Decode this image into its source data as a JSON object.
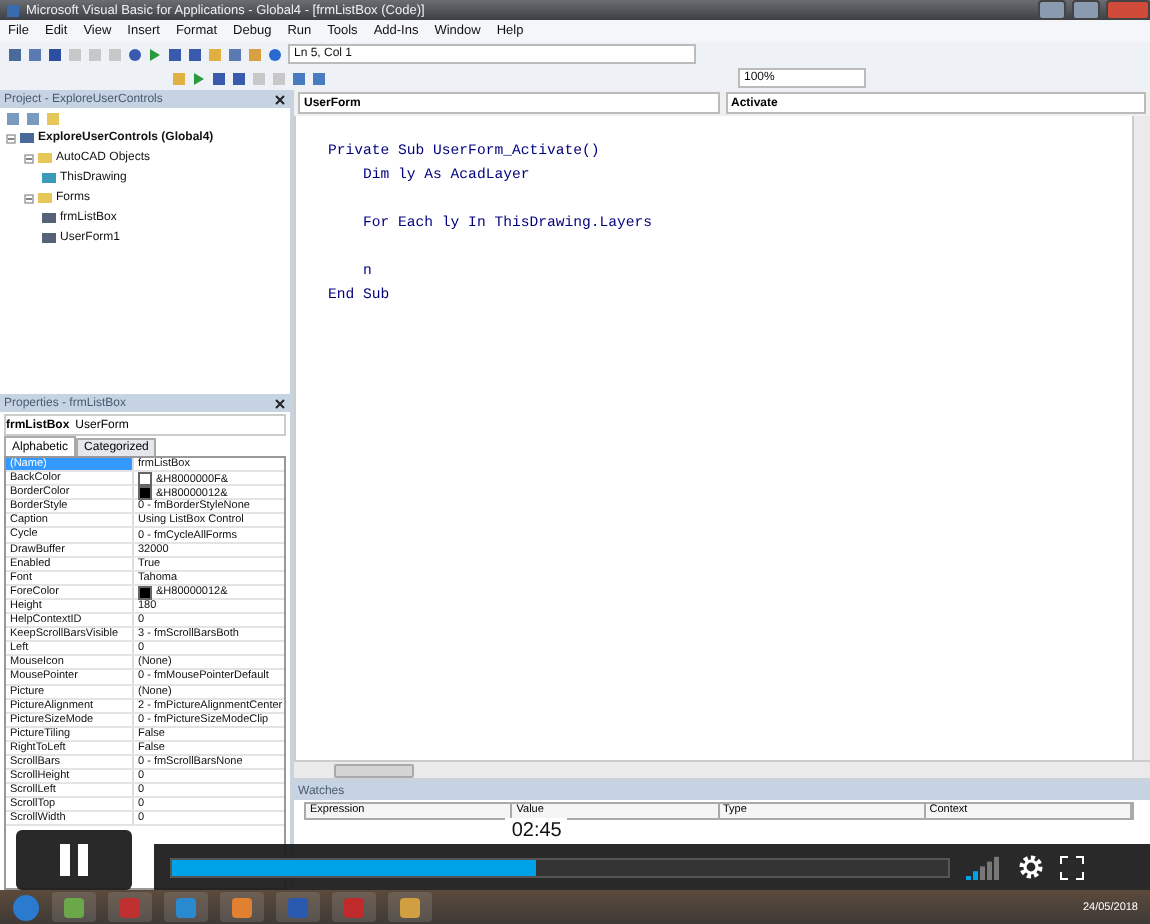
{
  "window": {
    "title": "Microsoft Visual Basic for Applications - Global4 - [frmListBox (Code)]"
  },
  "menu": [
    "File",
    "Edit",
    "View",
    "Insert",
    "Format",
    "Debug",
    "Run",
    "Tools",
    "Add-Ins",
    "Window",
    "Help"
  ],
  "toolbar": {
    "position": "Ln 5, Col 1",
    "zoom": "100%"
  },
  "project": {
    "title": "Project - ExploreUserControls",
    "tree": [
      {
        "label": "ExploreUserControls (Global4)",
        "kind": "project",
        "expanded": true,
        "children": [
          {
            "label": "AutoCAD Objects",
            "kind": "folder",
            "expanded": true,
            "children": [
              {
                "label": "ThisDrawing",
                "kind": "document"
              }
            ]
          },
          {
            "label": "Forms",
            "kind": "folder",
            "expanded": true,
            "children": [
              {
                "label": "frmListBox",
                "kind": "form"
              },
              {
                "label": "UserForm1",
                "kind": "form"
              }
            ]
          }
        ]
      }
    ]
  },
  "properties": {
    "title": "Properties - frmListBox",
    "object": "frmListBox",
    "object_type": "UserForm",
    "tabs": [
      {
        "label": "Alphabetic",
        "selected": true
      },
      {
        "label": "Categorized",
        "selected": false
      }
    ],
    "rows": [
      {
        "name": "(Name)",
        "value": "frmListBox",
        "selected": true
      },
      {
        "name": "BackColor",
        "value": "&H8000000F&",
        "selected": false,
        "color": "#ffffff"
      },
      {
        "name": "BorderColor",
        "value": "&H80000012&",
        "selected": false,
        "color": "#000000"
      },
      {
        "name": "BorderStyle",
        "value": "0 - fmBorderStyleNone",
        "selected": false
      },
      {
        "name": "Caption",
        "value": "Using ListBox Control",
        "selected": false
      },
      {
        "name": "Cycle",
        "value": "0 - fmCycleAllForms",
        "selected": false
      },
      {
        "name": "DrawBuffer",
        "value": "32000",
        "selected": false
      },
      {
        "name": "Enabled",
        "value": "True",
        "selected": false
      },
      {
        "name": "Font",
        "value": "Tahoma",
        "selected": false
      },
      {
        "name": "ForeColor",
        "value": "&H80000012&",
        "selected": false,
        "color": "#000000"
      },
      {
        "name": "Height",
        "value": "180",
        "selected": false
      },
      {
        "name": "HelpContextID",
        "value": "0",
        "selected": false
      },
      {
        "name": "KeepScrollBarsVisible",
        "value": "3 - fmScrollBarsBoth",
        "selected": false
      },
      {
        "name": "Left",
        "value": "0",
        "selected": false
      },
      {
        "name": "MouseIcon",
        "value": "(None)",
        "selected": false
      },
      {
        "name": "MousePointer",
        "value": "0 - fmMousePointerDefault",
        "selected": false
      },
      {
        "name": "Picture",
        "value": "(None)",
        "selected": false
      },
      {
        "name": "PictureAlignment",
        "value": "2 - fmPictureAlignmentCenter",
        "selected": false
      },
      {
        "name": "PictureSizeMode",
        "value": "0 - fmPictureSizeModeClip",
        "selected": false
      },
      {
        "name": "PictureTiling",
        "value": "False",
        "selected": false
      },
      {
        "name": "RightToLeft",
        "value": "False",
        "selected": false
      },
      {
        "name": "ScrollBars",
        "value": "0 - fmScrollBarsNone",
        "selected": false
      },
      {
        "name": "ScrollHeight",
        "value": "0",
        "selected": false
      },
      {
        "name": "ScrollLeft",
        "value": "0",
        "selected": false
      },
      {
        "name": "ScrollTop",
        "value": "0",
        "selected": false
      },
      {
        "name": "ScrollWidth",
        "value": "0",
        "selected": false
      }
    ]
  },
  "code": {
    "object": "UserForm",
    "procedure": "Activate",
    "blocks": [
      [
        "Private Sub UserForm_Activate()",
        "    Dim ly As AcadLayer"
      ],
      [
        "    For Each ly In ThisDrawing.Layers"
      ],
      [
        "    n",
        "End Sub"
      ]
    ]
  },
  "watches": {
    "title": "Watches",
    "columns": [
      "Expression",
      "Value",
      "Type",
      "Context"
    ]
  },
  "player": {
    "time": "02:45",
    "level": 0.47,
    "playing": true
  },
  "taskbar": {
    "date": "24/05/2018"
  }
}
